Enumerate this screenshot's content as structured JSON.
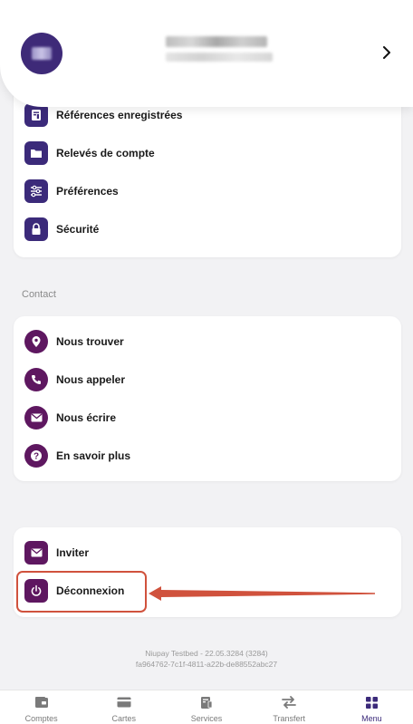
{
  "profile": {
    "chevron_icon": "chevron-right-icon",
    "avatar_color": "#3e2a78"
  },
  "settings_items": [
    {
      "label": "Références enregistrées",
      "icon": "saved-references-icon"
    },
    {
      "label": "Relevés de compte",
      "icon": "folder-icon"
    },
    {
      "label": "Préférences",
      "icon": "sliders-icon"
    },
    {
      "label": "Sécurité",
      "icon": "lock-icon"
    }
  ],
  "contact": {
    "title": "Contact",
    "items": [
      {
        "label": "Nous trouver",
        "icon": "location-pin-icon"
      },
      {
        "label": "Nous appeler",
        "icon": "phone-icon"
      },
      {
        "label": "Nous écrire",
        "icon": "mail-icon"
      },
      {
        "label": "En savoir plus",
        "icon": "help-icon"
      }
    ]
  },
  "account_actions": [
    {
      "label": "Inviter",
      "icon": "invite-mail-icon"
    },
    {
      "label": "Déconnexion",
      "icon": "power-icon"
    }
  ],
  "version": {
    "line1": "Niupay Testbed - 22.05.3284 (3284)",
    "line2": "fa964762-7c1f-4811-a22b-de88552abc27"
  },
  "bottom_nav": [
    {
      "label": "Comptes",
      "icon": "wallet-icon",
      "active": false
    },
    {
      "label": "Cartes",
      "icon": "card-icon",
      "active": false
    },
    {
      "label": "Services",
      "icon": "services-icon",
      "active": false
    },
    {
      "label": "Transfert",
      "icon": "transfer-arrows-icon",
      "active": false
    },
    {
      "label": "Menu",
      "icon": "grid-menu-icon",
      "active": true
    }
  ],
  "colors": {
    "navy": "#3b2a7a",
    "plum": "#5e1760",
    "highlight": "#d0523d"
  }
}
